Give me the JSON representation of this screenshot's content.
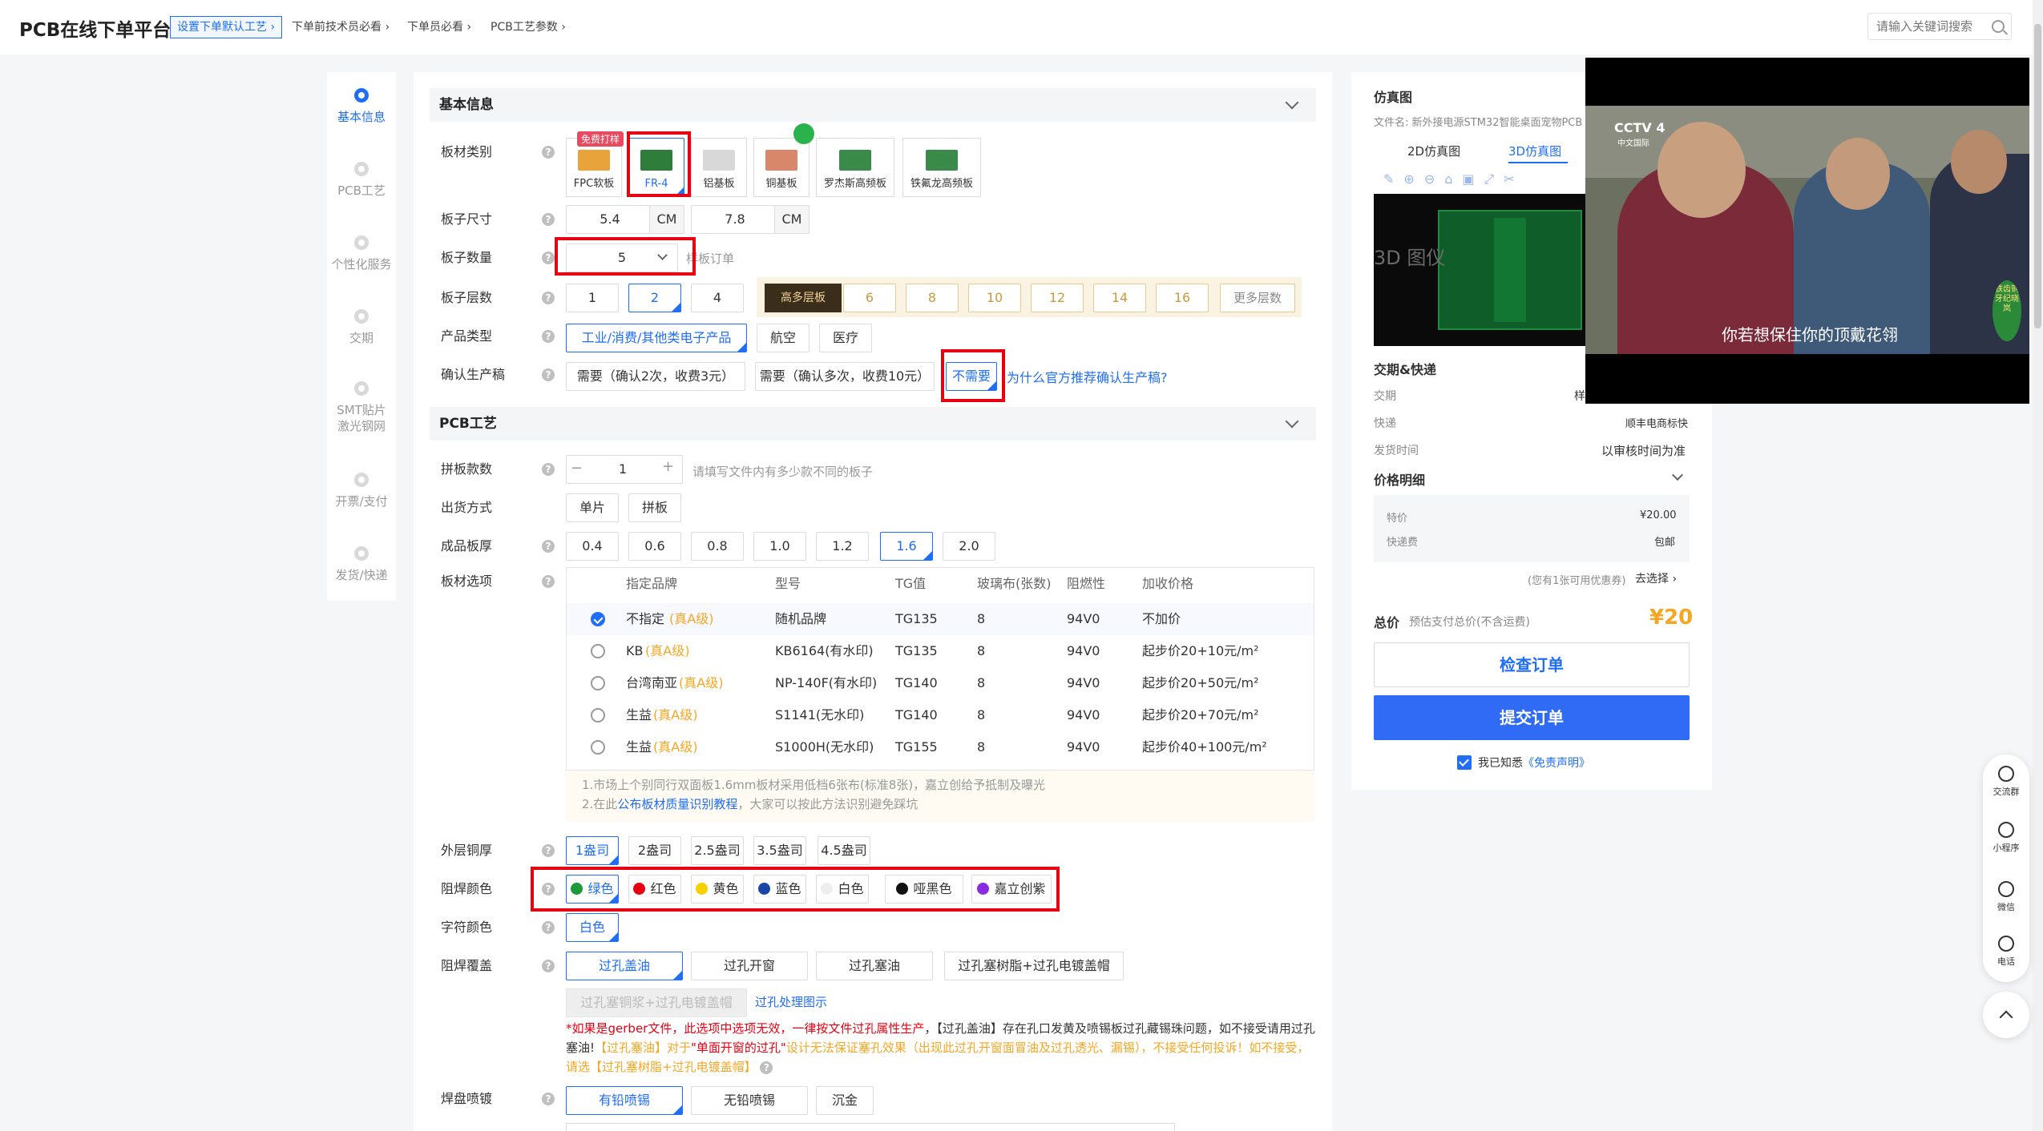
{
  "header": {
    "brand": "PCB在线下单平台",
    "breadcrumbs": [
      "设置下单默认工艺 ›",
      "下单前技术员必看 ›",
      "下单员必看 ›",
      "PCB工艺参数 ›"
    ],
    "search_placeholder": "请输入关键词搜索"
  },
  "steps": [
    "基本信息",
    "PCB工艺",
    "个性化服务",
    "交期",
    "SMT贴片\n激光钢网",
    "开票/支付",
    "发货/快递"
  ],
  "basic": {
    "title": "基本信息",
    "labels": {
      "material": "板材类别",
      "size": "板子尺寸",
      "qty": "板子数量",
      "layers": "板子层数",
      "product": "产品类型",
      "confirm": "确认生产稿"
    },
    "materials": [
      "FPC软板",
      "FR-4",
      "铝基板",
      "铜基板",
      "罗杰斯高频板",
      "铁氟龙高频板"
    ],
    "free_badge": "免费打样",
    "size_w": "5.4",
    "size_h": "7.8",
    "unit": "CM",
    "qty_value": "5",
    "qty_hint": "样板订单",
    "layers_basic": [
      "1",
      "2",
      "4"
    ],
    "high_layer_tag": "高多层板",
    "layers_high": [
      "6",
      "8",
      "10",
      "12",
      "14",
      "16"
    ],
    "more_layers": "更多层数",
    "product_types": [
      "工业/消费/其他类电子产品",
      "航空",
      "医疗"
    ],
    "confirm_opts": [
      "需要（确认2次，收费3元）",
      "需要（确认多次，收费10元）",
      "不需要"
    ],
    "confirm_link": "为什么官方推荐确认生产稿?"
  },
  "pcb": {
    "title": "PCB工艺",
    "labels": {
      "panel": "拼板款数",
      "ship": "出货方式",
      "thickness": "成品板厚",
      "board": "板材选项",
      "copper": "外层铜厚",
      "mask": "阻焊颜色",
      "silk": "字符颜色",
      "cover": "阻焊覆盖",
      "pad": "焊盘喷镀"
    },
    "panel_value": "1",
    "panel_minus": "−",
    "panel_plus": "+",
    "panel_hint": "请填写文件内有多少款不同的板子",
    "ship_opts": [
      "单片",
      "拼板"
    ],
    "thickness_opts": [
      "0.4",
      "0.6",
      "0.8",
      "1.0",
      "1.2",
      "1.6",
      "2.0"
    ],
    "board_headers": [
      "指定品牌",
      "型号",
      "TG值",
      "玻璃布(张数)",
      "阻燃性",
      "加收价格"
    ],
    "board_rows": [
      {
        "brand": "不指定",
        "grade": "(真A级)",
        "model": "随机品牌",
        "tg": "TG135",
        "cloth": "8",
        "fr": "94V0",
        "price": "不加价"
      },
      {
        "brand": "KB",
        "grade": "(真A级)",
        "model": "KB6164(有水印)",
        "tg": "TG135",
        "cloth": "8",
        "fr": "94V0",
        "price": "起步价20+10元/m²"
      },
      {
        "brand": "台湾南亚",
        "grade": "(真A级)",
        "model": "NP-140F(有水印)",
        "tg": "TG140",
        "cloth": "8",
        "fr": "94V0",
        "price": "起步价20+50元/m²"
      },
      {
        "brand": "生益",
        "grade": "(真A级)",
        "model": "S1141(无水印)",
        "tg": "TG140",
        "cloth": "8",
        "fr": "94V0",
        "price": "起步价20+70元/m²"
      },
      {
        "brand": "生益",
        "grade": "(真A级)",
        "model": "S1000H(无水印)",
        "tg": "TG155",
        "cloth": "8",
        "fr": "94V0",
        "price": "起步价40+100元/m²"
      }
    ],
    "board_note1": "1.市场上个别同行双面板1.6mm板材采用低档6张布(标准8张)，嘉立创给予抵制及曝光",
    "board_note2_pre": "2.在此",
    "board_note2_link": "公布板材质量识别教程",
    "board_note2_post": "，大家可以按此方法识别避免踩坑",
    "copper_opts": [
      "1盎司",
      "2盎司",
      "2.5盎司",
      "3.5盎司",
      "4.5盎司"
    ],
    "mask_colors": [
      {
        "name": "绿色",
        "color": "#1a9a3a"
      },
      {
        "name": "红色",
        "color": "#e60012"
      },
      {
        "name": "黄色",
        "color": "#f7d000"
      },
      {
        "name": "蓝色",
        "color": "#1846a8"
      },
      {
        "name": "白色",
        "color": "#eeeeee"
      },
      {
        "name": "哑黑色",
        "color": "#111111"
      },
      {
        "name": "嘉立创紫",
        "color": "#8a2be2"
      }
    ],
    "silk_value": "白色",
    "cover_opts": [
      "过孔盖油",
      "过孔开窗",
      "过孔塞油",
      "过孔塞树脂+过孔电镀盖帽"
    ],
    "cover_disabled": "过孔塞铜浆+过孔电镀盖帽",
    "cover_link": "过孔处理图示",
    "warn_1": "*如果是gerber文件，此选项中选项无效，一律按文件过孔属性生产",
    "warn_2": "，【过孔盖油】存在孔口发黄及喷锡板过孔藏锡珠问题，如不接受请用过孔塞油!",
    "warn_3": "【过孔塞油】对于",
    "warn_4": "\"单面开窗的过孔\"",
    "warn_5": "设计无法保证塞孔效果（出现此过孔开窗面冒油及过孔透光、漏锡），不接受任何投诉！如不接受，请选【过孔塞树脂+过孔电镀盖帽】",
    "pad_opts": [
      "有铅喷锡",
      "无铅喷锡",
      "沉金"
    ]
  },
  "right": {
    "sim_title": "仿真图",
    "file_label": "文件名: 新外接电源STM32智能桌面宠物PCB",
    "tabs": [
      "2D仿真图",
      "3D仿真图"
    ],
    "pcb_overlay": "3D 图仪",
    "delivery_title": "交期&快递",
    "rows": [
      {
        "k": "交期",
        "v": "样"
      },
      {
        "k": "快递",
        "v": "顺丰电商标快"
      },
      {
        "k": "发货时间",
        "v": "以审核时间为准"
      }
    ],
    "price_title": "价格明细",
    "price_rows": [
      {
        "k": "特价",
        "v": "¥20.00"
      },
      {
        "k": "快递费",
        "v": "包邮"
      }
    ],
    "coupon_hint": "(您有1张可用优惠券)",
    "coupon_link": "去选择 ›",
    "total_label": "总价",
    "total_hint": "预估支付总价(不含运费)",
    "total_value": "¥20",
    "check_btn": "检查订单",
    "submit_btn": "提交订单",
    "agree_pre": "我已知悉",
    "agree_link": "《免责声明》"
  },
  "video": {
    "channel": "CCTV 4",
    "channel_sub": "中文国际",
    "subtitle": "你若想保住你的顶戴花翎",
    "seal": "铁齿铜牙纪晓岚"
  },
  "floating": [
    "交流群",
    "小程序",
    "微信",
    "电话"
  ],
  "colors": {
    "accent": "#1f6ef5",
    "danger": "#e60012",
    "price": "#f5a623"
  }
}
